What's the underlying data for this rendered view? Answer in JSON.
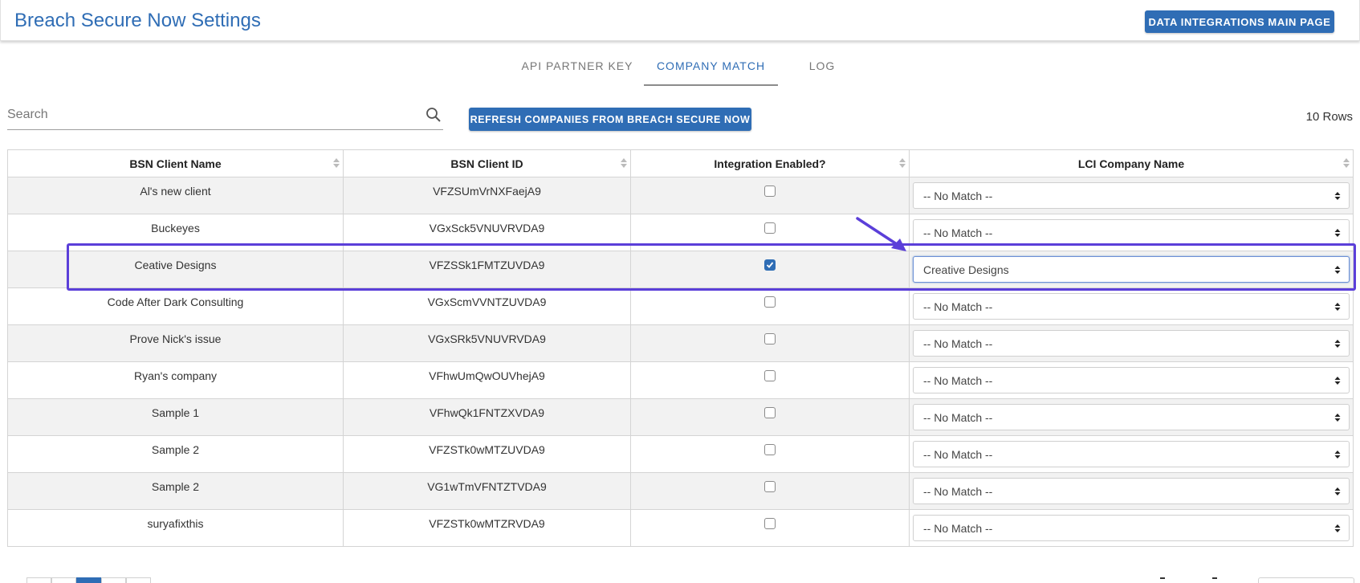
{
  "header": {
    "title": "Breach Secure Now Settings",
    "main_button_label": "DATA INTEGRATIONS MAIN PAGE"
  },
  "tabs": [
    {
      "label": "API PARTNER KEY",
      "active": false
    },
    {
      "label": "COMPANY MATCH",
      "active": true
    },
    {
      "label": "LOG",
      "active": false
    }
  ],
  "toolbar": {
    "search_placeholder": "Search",
    "search_value": "",
    "refresh_label": "REFRESH COMPANIES FROM BREACH SECURE NOW",
    "rows_label": "10 Rows"
  },
  "table": {
    "columns": [
      "BSN Client Name",
      "BSN Client ID",
      "Integration Enabled?",
      "LCI Company Name"
    ],
    "rows": [
      {
        "name": "Al's new client",
        "id": "VFZSUmVrNXFaejA9",
        "enabled": false,
        "company": "-- No Match --"
      },
      {
        "name": "Buckeyes",
        "id": "VGxSck5VNUVRVDA9",
        "enabled": false,
        "company": "-- No Match --"
      },
      {
        "name": "Ceative Designs",
        "id": "VFZSSk1FMTZUVDA9",
        "enabled": true,
        "company": "Creative Designs"
      },
      {
        "name": "Code After Dark Consulting",
        "id": "VGxScmVVNTZUVDA9",
        "enabled": false,
        "company": "-- No Match --"
      },
      {
        "name": "Prove Nick's issue",
        "id": "VGxSRk5VNUVRVDA9",
        "enabled": false,
        "company": "-- No Match --"
      },
      {
        "name": "Ryan's company",
        "id": "VFhwUmQwOUVhejA9",
        "enabled": false,
        "company": "-- No Match --"
      },
      {
        "name": "Sample 1",
        "id": "VFhwQk1FNTZXVDA9",
        "enabled": false,
        "company": "-- No Match --"
      },
      {
        "name": "Sample 2",
        "id": "VFZSTk0wMTZUVDA9",
        "enabled": false,
        "company": "-- No Match --"
      },
      {
        "name": "Sample 2",
        "id": "VG1wTmVFNTZTVDA9",
        "enabled": false,
        "company": "-- No Match --"
      },
      {
        "name": "suryafixthis",
        "id": "VFZSTk0wMTZRVDA9",
        "enabled": false,
        "company": "-- No Match --"
      }
    ]
  },
  "colors": {
    "accent": "#2f6db5",
    "highlight": "#5b3fd9",
    "row_alt": "#f2f2f2"
  },
  "icons": {
    "search": "search-icon",
    "sort": "sort-icon",
    "select_arrow": "select-arrow-icon",
    "checkbox_check": "check-icon",
    "annotation_arrow": "annotation-arrow"
  }
}
